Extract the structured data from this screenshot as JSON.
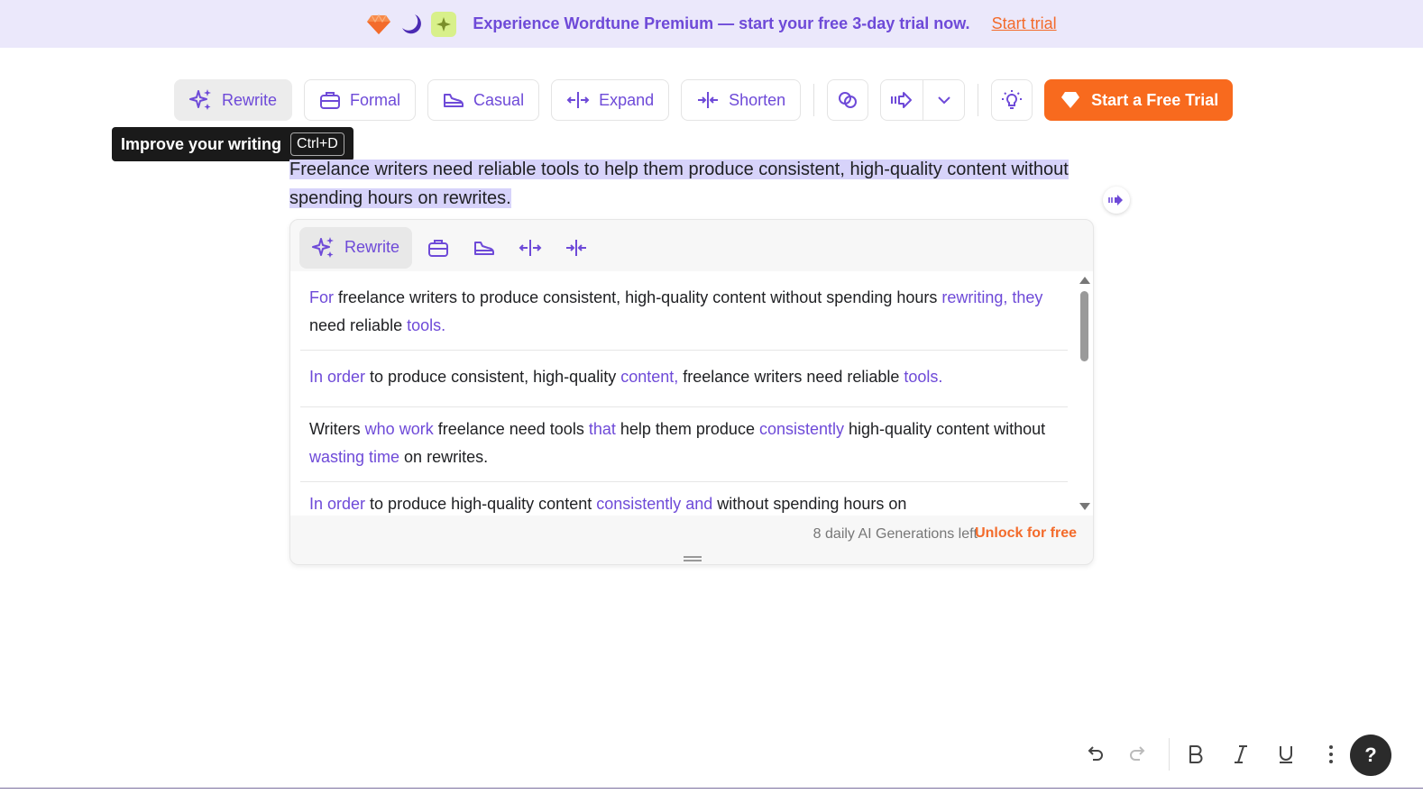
{
  "banner": {
    "text": "Experience Wordtune Premium — start your free 3-day trial now.",
    "link": "Start trial",
    "icons": [
      "diamond-icon",
      "moon-icon",
      "sparkle-icon"
    ]
  },
  "toolbar": {
    "rewrite": "Rewrite",
    "formal": "Formal",
    "casual": "Casual",
    "expand": "Expand",
    "shorten": "Shorten",
    "trial_button": "Start a Free Trial"
  },
  "tooltip": {
    "text": "Improve your writing",
    "shortcut": "Ctrl+D"
  },
  "editor": {
    "selected_text": "Freelance writers need reliable tools to help them produce consistent, high-quality content without spending hours on rewrites."
  },
  "panel": {
    "rewrite_label": "Rewrite",
    "suggestions": [
      [
        {
          "t": "For",
          "c": true
        },
        {
          "t": " freelance writers to produce consistent, high-quality content without spending hours ",
          "c": false
        },
        {
          "t": "rewriting, they",
          "c": true
        },
        {
          "t": " need reliable ",
          "c": false
        },
        {
          "t": "tools.",
          "c": true
        }
      ],
      [
        {
          "t": "In order",
          "c": true
        },
        {
          "t": " to produce consistent, high-quality ",
          "c": false
        },
        {
          "t": "content,",
          "c": true
        },
        {
          "t": " freelance writers need reliable ",
          "c": false
        },
        {
          "t": "tools.",
          "c": true
        }
      ],
      [
        {
          "t": "Writers ",
          "c": false
        },
        {
          "t": "who work",
          "c": true
        },
        {
          "t": " freelance need tools ",
          "c": false
        },
        {
          "t": "that",
          "c": true
        },
        {
          "t": " help them produce ",
          "c": false
        },
        {
          "t": "consistently",
          "c": true
        },
        {
          "t": " high-quality content without ",
          "c": false
        },
        {
          "t": "wasting time",
          "c": true
        },
        {
          "t": " on rewrites.",
          "c": false
        }
      ],
      [
        {
          "t": "In order",
          "c": true
        },
        {
          "t": " to produce high-quality content ",
          "c": false
        },
        {
          "t": "consistently and",
          "c": true
        },
        {
          "t": " without spending hours on",
          "c": false
        }
      ]
    ],
    "generations_left": "8 daily AI Generations left",
    "unlock": "Unlock for free"
  },
  "bottom": {
    "help": "?"
  },
  "colors": {
    "accent": "#6e4ad8",
    "orange": "#f86a1e",
    "banner_bg": "#ebe8fb",
    "highlight": "#d7d3fa"
  }
}
